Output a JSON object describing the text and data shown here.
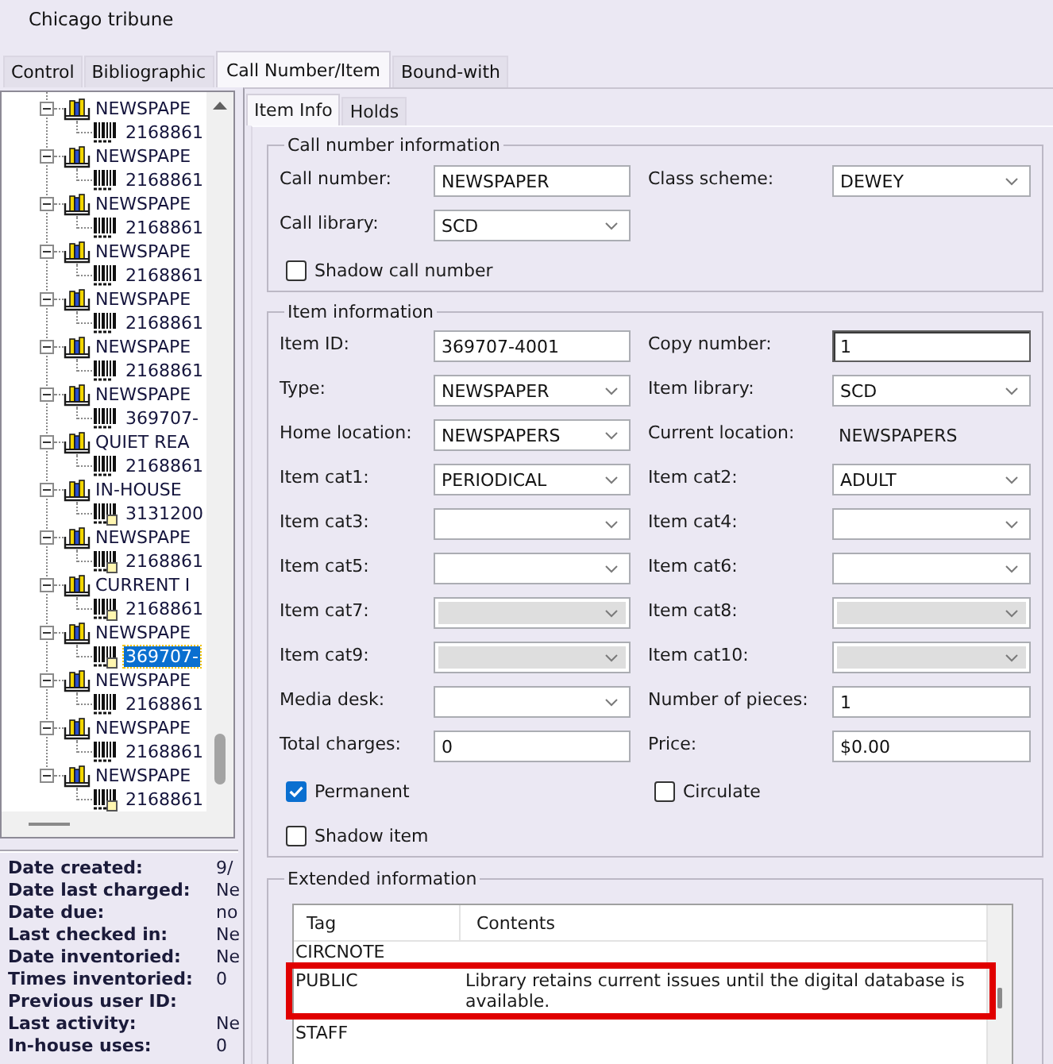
{
  "window": {
    "title": "Chicago tribune"
  },
  "tabs": [
    {
      "label": "Control",
      "selected": false
    },
    {
      "label": "Bibliographic",
      "selected": false
    },
    {
      "label": "Call Number/Item",
      "selected": true
    },
    {
      "label": "Bound-with",
      "selected": false
    }
  ],
  "tree": [
    {
      "label": "NEWSPAPE",
      "expanded": true,
      "selected": false,
      "children": [
        {
          "label": "2168861",
          "note": false,
          "selected": false
        }
      ]
    },
    {
      "label": "NEWSPAPE",
      "expanded": true,
      "selected": false,
      "children": [
        {
          "label": "2168861",
          "note": false,
          "selected": false
        }
      ]
    },
    {
      "label": "NEWSPAPE",
      "expanded": true,
      "selected": false,
      "children": [
        {
          "label": "2168861",
          "note": false,
          "selected": false
        }
      ]
    },
    {
      "label": "NEWSPAPE",
      "expanded": true,
      "selected": false,
      "children": [
        {
          "label": "2168861",
          "note": false,
          "selected": false
        }
      ]
    },
    {
      "label": "NEWSPAPE",
      "expanded": true,
      "selected": false,
      "children": [
        {
          "label": "2168861",
          "note": false,
          "selected": false
        }
      ]
    },
    {
      "label": "NEWSPAPE",
      "expanded": true,
      "selected": false,
      "children": [
        {
          "label": "2168861",
          "note": false,
          "selected": false
        }
      ]
    },
    {
      "label": "NEWSPAPE",
      "expanded": true,
      "selected": false,
      "children": [
        {
          "label": "369707-",
          "note": false,
          "selected": false
        }
      ]
    },
    {
      "label": "QUIET REA",
      "expanded": true,
      "selected": false,
      "children": [
        {
          "label": "2168861",
          "note": false,
          "selected": false
        }
      ]
    },
    {
      "label": "IN-HOUSE",
      "expanded": true,
      "selected": false,
      "children": [
        {
          "label": "3131200",
          "note": true,
          "selected": false
        }
      ]
    },
    {
      "label": "NEWSPAPE",
      "expanded": true,
      "selected": false,
      "children": [
        {
          "label": "2168861",
          "note": true,
          "selected": false
        }
      ]
    },
    {
      "label": "CURRENT I",
      "expanded": true,
      "selected": false,
      "children": [
        {
          "label": "2168861",
          "note": true,
          "selected": false
        }
      ]
    },
    {
      "label": "NEWSPAPE",
      "expanded": true,
      "selected": false,
      "children": [
        {
          "label": "369707-",
          "note": true,
          "selected": true
        }
      ]
    },
    {
      "label": "NEWSPAPE",
      "expanded": true,
      "selected": false,
      "children": [
        {
          "label": "2168861",
          "note": false,
          "selected": false
        }
      ]
    },
    {
      "label": "NEWSPAPE",
      "expanded": true,
      "selected": false,
      "children": [
        {
          "label": "2168861",
          "note": false,
          "selected": false
        }
      ]
    },
    {
      "label": "NEWSPAPE",
      "expanded": true,
      "selected": false,
      "children": [
        {
          "label": "2168861",
          "note": true,
          "selected": false
        }
      ]
    }
  ],
  "record_info": [
    {
      "label": "Date created:",
      "value": "9/"
    },
    {
      "label": "Date last charged:",
      "value": "Ne"
    },
    {
      "label": "Date due:",
      "value": "no"
    },
    {
      "label": "Last checked in:",
      "value": "Ne"
    },
    {
      "label": "Date inventoried:",
      "value": "Ne"
    },
    {
      "label": "Times inventoried:",
      "value": "0"
    },
    {
      "label": "Previous user ID:"
    },
    {
      "label": "Last activity:",
      "value": "Ne"
    },
    {
      "label": "In-house uses:",
      "value": "0"
    }
  ],
  "item_tabs": [
    {
      "label": "Item Info",
      "selected": true
    },
    {
      "label": "Holds",
      "selected": false
    }
  ],
  "call_number_information": {
    "title": "Call number information",
    "fields": [
      {
        "label": "Call number:",
        "kind": "text",
        "value": "NEWSPAPER",
        "disabled": false,
        "focused": false
      },
      {
        "label": "Class scheme:",
        "kind": "select",
        "value": "DEWEY",
        "disabled": false,
        "focused": false
      },
      {
        "label": "Call library:",
        "kind": "select",
        "value": "SCD",
        "disabled": false,
        "focused": false
      }
    ],
    "checkboxes": [
      {
        "label": "Shadow call number",
        "checked": false
      }
    ]
  },
  "item_information": {
    "title": "Item information",
    "fields": [
      {
        "label": "Item ID:",
        "kind": "text",
        "value": "369707-4001",
        "disabled": false,
        "focused": false
      },
      {
        "label": "Copy number:",
        "kind": "text",
        "value": "1",
        "disabled": false,
        "focused": true
      },
      {
        "label": "Type:",
        "kind": "select",
        "value": "NEWSPAPER",
        "disabled": false,
        "focused": false
      },
      {
        "label": "Item library:",
        "kind": "select",
        "value": "SCD",
        "disabled": false,
        "focused": false
      },
      {
        "label": "Home location:",
        "kind": "select",
        "value": "NEWSPAPERS",
        "disabled": false,
        "focused": false
      },
      {
        "label": "Current location:",
        "kind": "static",
        "value": "NEWSPAPERS",
        "disabled": false,
        "focused": false
      },
      {
        "label": "Item cat1:",
        "kind": "select",
        "value": "PERIODICAL",
        "disabled": false,
        "focused": false
      },
      {
        "label": "Item cat2:",
        "kind": "select",
        "value": "ADULT",
        "disabled": false,
        "focused": false
      },
      {
        "label": "Item cat3:",
        "kind": "select",
        "disabled": false,
        "focused": false
      },
      {
        "label": "Item cat4:",
        "kind": "select",
        "disabled": false,
        "focused": false
      },
      {
        "label": "Item cat5:",
        "kind": "select",
        "disabled": false,
        "focused": false
      },
      {
        "label": "Item cat6:",
        "kind": "select",
        "disabled": false,
        "focused": false
      },
      {
        "label": "Item cat7:",
        "kind": "select",
        "disabled": true,
        "focused": false
      },
      {
        "label": "Item cat8:",
        "kind": "select",
        "disabled": true,
        "focused": false
      },
      {
        "label": "Item cat9:",
        "kind": "select",
        "disabled": true,
        "focused": false
      },
      {
        "label": "Item cat10:",
        "kind": "select",
        "disabled": true,
        "focused": false
      },
      {
        "label": "Media desk:",
        "kind": "select",
        "disabled": false,
        "focused": false
      },
      {
        "label": "Number of pieces:",
        "kind": "text",
        "value": "1",
        "disabled": false,
        "focused": false
      },
      {
        "label": "Total charges:",
        "kind": "text",
        "value": "0",
        "disabled": false,
        "focused": false
      },
      {
        "label": "Price:",
        "kind": "text",
        "value": "$0.00",
        "disabled": false,
        "focused": false
      }
    ],
    "checkboxes": [
      {
        "label": "Permanent",
        "checked": true
      },
      {
        "label": "Circulate",
        "checked": false
      },
      {
        "label": "Shadow item",
        "checked": false
      }
    ]
  },
  "extended_information": {
    "title": "Extended information",
    "columns": [
      "Tag",
      "Contents"
    ],
    "rows": [
      {
        "tag": "CIRCNOTE",
        "highlighted": false
      },
      {
        "tag": "PUBLIC",
        "contents": "Library retains current issues until the digital database is available.",
        "highlighted": true
      },
      {
        "tag": "STAFF",
        "highlighted": false
      }
    ]
  }
}
